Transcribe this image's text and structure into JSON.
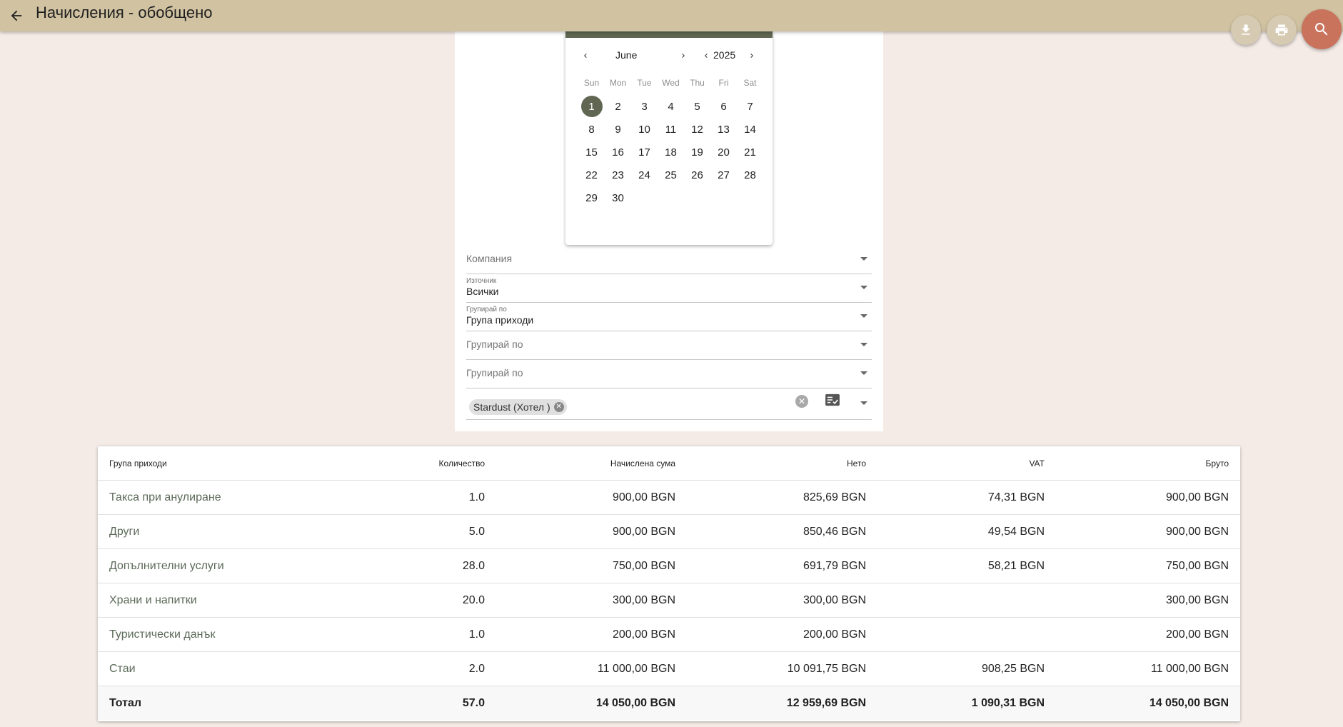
{
  "header": {
    "title": "Начисления - обобщено"
  },
  "calendar": {
    "month": "June",
    "year": "2025",
    "weekdays": [
      "Sun",
      "Mon",
      "Tue",
      "Wed",
      "Thu",
      "Fri",
      "Sat"
    ],
    "days": [
      "1",
      "2",
      "3",
      "4",
      "5",
      "6",
      "7",
      "8",
      "9",
      "10",
      "11",
      "12",
      "13",
      "14",
      "15",
      "16",
      "17",
      "18",
      "19",
      "20",
      "21",
      "22",
      "23",
      "24",
      "25",
      "26",
      "27",
      "28",
      "29",
      "30"
    ],
    "selected_day": "1"
  },
  "filters": {
    "company": {
      "placeholder": "Компания"
    },
    "source": {
      "label": "Източник",
      "value": "Всички"
    },
    "group1": {
      "label": "Групирай по",
      "value": "Група приходи"
    },
    "group2": {
      "placeholder": "Групирай по"
    },
    "group3": {
      "placeholder": "Групирай по"
    },
    "property": {
      "chip": "Stardust (Хотел )"
    }
  },
  "table": {
    "headers": [
      "Група приходи",
      "Количество",
      "Начислена сума",
      "Нето",
      "VAT",
      "Бруто"
    ],
    "rows": [
      [
        "Такса при анулиране",
        "1.0",
        "900,00 BGN",
        "825,69 BGN",
        "74,31 BGN",
        "900,00 BGN"
      ],
      [
        "Други",
        "5.0",
        "900,00 BGN",
        "850,46 BGN",
        "49,54 BGN",
        "900,00 BGN"
      ],
      [
        "Допълнителни услуги",
        "28.0",
        "750,00 BGN",
        "691,79 BGN",
        "58,21 BGN",
        "750,00 BGN"
      ],
      [
        "Храни и напитки",
        "20.0",
        "300,00 BGN",
        "300,00 BGN",
        "",
        "300,00 BGN"
      ],
      [
        "Туристически данък",
        "1.0",
        "200,00 BGN",
        "200,00 BGN",
        "",
        "200,00 BGN"
      ],
      [
        "Стаи",
        "2.0",
        "11 000,00 BGN",
        "10 091,75 BGN",
        "908,25 BGN",
        "11 000,00 BGN"
      ]
    ],
    "total": [
      "Тотал",
      "57.0",
      "14 050,00 BGN",
      "12 959,69 BGN",
      "1 090,31 BGN",
      "14 050,00 BGN"
    ]
  },
  "colors": {
    "topbar": "#d1c3a2",
    "accent": "#5f6752",
    "search_fab": "#c9735d",
    "background": "#f4ebe6"
  },
  "icons": {
    "back": "arrow-back-icon",
    "download": "download-icon",
    "print": "print-icon",
    "search": "search-icon"
  }
}
